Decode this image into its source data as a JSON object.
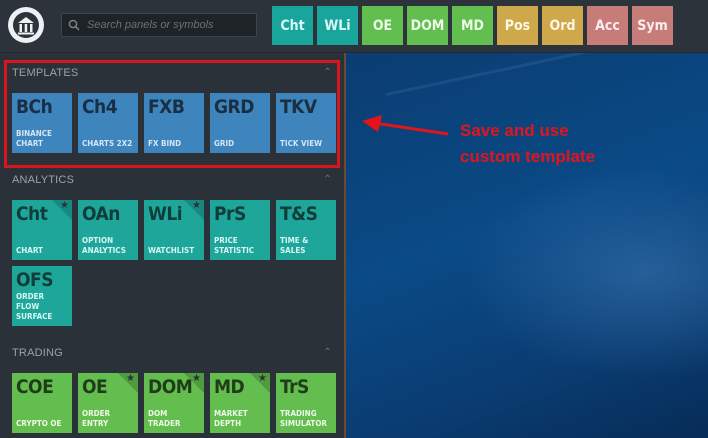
{
  "search": {
    "placeholder": "Search panels or symbols"
  },
  "toolbar": [
    {
      "label": "Cht",
      "style": "teal"
    },
    {
      "label": "WLi",
      "style": "teal"
    },
    {
      "label": "OE",
      "style": "green"
    },
    {
      "label": "DOM",
      "style": "green"
    },
    {
      "label": "MD",
      "style": "green"
    },
    {
      "label": "Pos",
      "style": "yellow"
    },
    {
      "label": "Ord",
      "style": "yellow"
    },
    {
      "label": "Acc",
      "style": "red"
    },
    {
      "label": "Sym",
      "style": "red"
    }
  ],
  "sections": {
    "templates": {
      "title": "TEMPLATES",
      "tiles": [
        {
          "abbr": "BCh",
          "name": "BINANCE CHART",
          "starred": false
        },
        {
          "abbr": "Ch4",
          "name": "CHARTS 2X2",
          "starred": false
        },
        {
          "abbr": "FXB",
          "name": "FX BIND",
          "starred": false
        },
        {
          "abbr": "GRD",
          "name": "GRID",
          "starred": false
        },
        {
          "abbr": "TKV",
          "name": "TICK VIEW",
          "starred": false
        }
      ]
    },
    "analytics": {
      "title": "ANALYTICS",
      "tiles": [
        {
          "abbr": "Cht",
          "name": "CHART",
          "starred": true
        },
        {
          "abbr": "OAn",
          "name": "OPTION ANALYTICS",
          "starred": false
        },
        {
          "abbr": "WLi",
          "name": "WATCHLIST",
          "starred": true
        },
        {
          "abbr": "PrS",
          "name": "PRICE STATISTIC",
          "starred": false
        },
        {
          "abbr": "T&S",
          "name": "TIME & SALES",
          "starred": false
        },
        {
          "abbr": "OFS",
          "name": "ORDER FLOW SURFACE",
          "starred": false
        }
      ]
    },
    "trading": {
      "title": "TRADING",
      "tiles": [
        {
          "abbr": "COE",
          "name": "CRYPTO OE",
          "starred": false
        },
        {
          "abbr": "OE",
          "name": "ORDER ENTRY",
          "starred": true
        },
        {
          "abbr": "DOM",
          "name": "DOM TRADER",
          "starred": true
        },
        {
          "abbr": "MD",
          "name": "MARKET DEPTH",
          "starred": true
        },
        {
          "abbr": "TrS",
          "name": "TRADING SIMULATOR",
          "starred": false
        }
      ]
    }
  },
  "annotation": {
    "line1": "Save and use",
    "line2": "custom template"
  },
  "colors": {
    "highlight": "#d8141c",
    "template_tile": "#3e84bd",
    "analytics_tile": "#1ea69b",
    "trading_tile": "#63bd4f"
  }
}
